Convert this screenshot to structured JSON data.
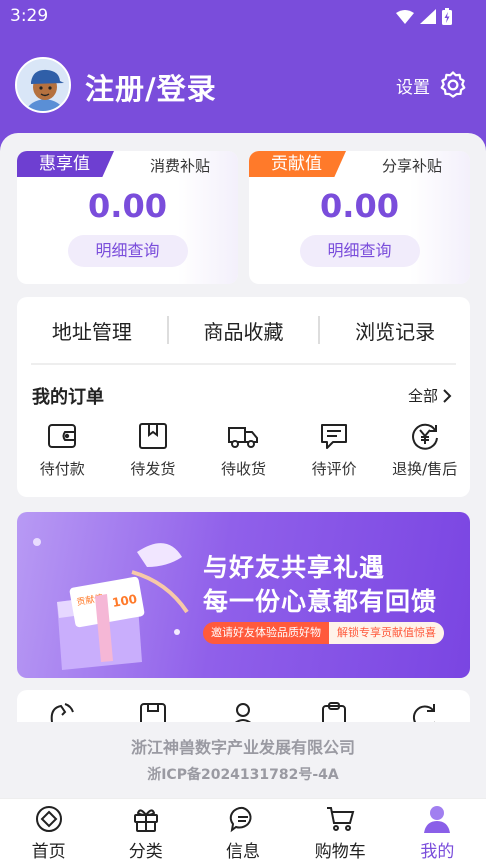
{
  "status_bar": {
    "time": "3:29"
  },
  "profile": {
    "login_label": "注册/登录",
    "settings_label": "设置"
  },
  "cards": [
    {
      "tag": "惠享值",
      "subsidy": "消费补贴",
      "value": "0.00",
      "detail": "明细查询",
      "tag_color": "#6e3fd1"
    },
    {
      "tag": "贡献值",
      "subsidy": "分享补贴",
      "value": "0.00",
      "detail": "明细查询",
      "tag_color": "#ff7a2a"
    }
  ],
  "quick_links": [
    "地址管理",
    "商品收藏",
    "浏览记录"
  ],
  "orders": {
    "title": "我的订单",
    "all_label": "全部",
    "items": [
      {
        "label": "待付款",
        "icon": "wallet-icon"
      },
      {
        "label": "待发货",
        "icon": "package-icon"
      },
      {
        "label": "待收货",
        "icon": "truck-icon"
      },
      {
        "label": "待评价",
        "icon": "comment-icon"
      },
      {
        "label": "退换/售后",
        "icon": "refund-icon"
      }
    ]
  },
  "banner": {
    "line1": "与好友共享礼遇",
    "line2": "每一份心意都有回馈",
    "pill_left": "邀请好友体验品质好物",
    "pill_right": "解锁专享贡献值惊喜",
    "gift_label": "贡献值",
    "gift_number": "100"
  },
  "footer": {
    "company": "浙江神兽数字产业发展有限公司",
    "icp": "浙ICP备2024131782号-4A"
  },
  "tabbar": [
    {
      "label": "首页",
      "icon": "home-icon"
    },
    {
      "label": "分类",
      "icon": "gift-icon"
    },
    {
      "label": "信息",
      "icon": "message-icon"
    },
    {
      "label": "购物车",
      "icon": "cart-icon"
    },
    {
      "label": "我的",
      "icon": "user-icon",
      "active": true
    }
  ],
  "colors": {
    "primary": "#7a4ddb",
    "accent_orange": "#ff7a2a",
    "background": "#f2f2f5"
  }
}
